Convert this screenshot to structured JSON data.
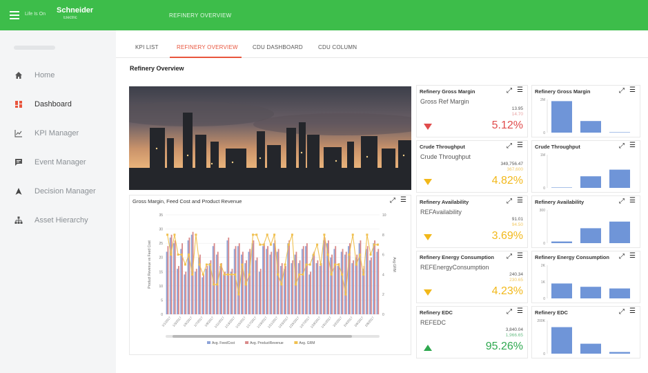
{
  "header": {
    "brand_small": "Life Is On",
    "brand": "Schneider",
    "brand_sub": "Electric",
    "page_title": "REFINERY OVERVIEW"
  },
  "sidebar": {
    "items": [
      {
        "label": "Home",
        "icon": "home-icon"
      },
      {
        "label": "Dashboard",
        "icon": "dashboard-icon"
      },
      {
        "label": "KPI Manager",
        "icon": "chart-line-icon"
      },
      {
        "label": "Event Manager",
        "icon": "message-icon"
      },
      {
        "label": "Decision Manager",
        "icon": "navigation-arrow-icon"
      },
      {
        "label": "Asset Hierarchy",
        "icon": "hierarchy-icon"
      }
    ]
  },
  "tabs": [
    "KPI LIST",
    "REFINERY OVERVIEW",
    "CDU DASHBOARD",
    "CDU COLUMN"
  ],
  "section_title": "Refinery Overview",
  "colors": {
    "header_green": "#3dbd4a",
    "tab_active": "#e8553d",
    "down_red": "#e04b4b",
    "down_yellow": "#f2b81a",
    "up_green": "#2ea84f",
    "feed_cost": "#8ea4d8",
    "product_revenue": "#d98a8a",
    "grm": "#f0c050",
    "mini_bar": "#6f95d8"
  },
  "kpis": [
    {
      "title": "Refinery Gross Margin",
      "sub": "Gross Ref Margin",
      "v1": "13.95",
      "v2": "14.70",
      "pct": "5.12%",
      "dir": "down",
      "color": "#e04b4b",
      "v2color": "#e8a0a0"
    },
    {
      "title": "Crude Throughput",
      "sub": "Crude Throughput",
      "v1": "349,756.47",
      "v2": "367,600",
      "pct": "4.82%",
      "dir": "down",
      "color": "#f2b81a",
      "v2color": "#f2c860"
    },
    {
      "title": "Refinery Availability",
      "sub": "REFAvailability",
      "v1": "91.01",
      "v2": "94.50",
      "pct": "3.69%",
      "dir": "down",
      "color": "#f2b81a",
      "v2color": "#f2c860"
    },
    {
      "title": "Refinery Energy Consumption",
      "sub": "REFEnergyConsumption",
      "v1": "240.34",
      "v2": "230.65",
      "pct": "4.23%",
      "dir": "down",
      "color": "#f2b81a",
      "v2color": "#f2c860"
    },
    {
      "title": "Refinery EDC",
      "sub": "REFEDC",
      "v1": "3,840.04",
      "v2": "1,966.65",
      "pct": "95.26%",
      "dir": "up",
      "color": "#2ea84f",
      "v2color": "#6bbf87"
    }
  ],
  "mini_charts": [
    {
      "title": "Refinery Gross Margin",
      "ticks": [
        "2M",
        "0"
      ],
      "values": [
        0.95,
        0.35,
        0
      ]
    },
    {
      "title": "Crude Throughput",
      "ticks": [
        "1M",
        "0"
      ],
      "values": [
        0,
        0.35,
        0.55
      ]
    },
    {
      "title": "Refinery Availability",
      "ticks": [
        "300",
        "0"
      ],
      "values": [
        0.05,
        0.45,
        0.65
      ]
    },
    {
      "title": "Refinery Energy Consumption",
      "ticks": [
        "2K",
        "1K",
        "0"
      ],
      "values": [
        0.45,
        0.35,
        0.3
      ]
    },
    {
      "title": "Refinery EDC",
      "ticks": [
        "200K",
        "0"
      ],
      "values": [
        0.8,
        0.3,
        0.05
      ]
    }
  ],
  "chart_data": {
    "type": "bar",
    "title": "Gross Margin, Feed Cost and Product Revenue",
    "ylabel": "Product Revenue vs Feed Cost",
    "y2label": "Avg GRM",
    "ylim": [
      0,
      35
    ],
    "y2lim": [
      0,
      10
    ],
    "yticks": [
      "35",
      "30",
      "25",
      "20",
      "15",
      "10",
      "5",
      "0"
    ],
    "y2ticks": [
      "10",
      "8",
      "6",
      "4",
      "2",
      "0"
    ],
    "xticks": [
      "1/1/2017",
      "1/3/2017",
      "1/5/2017",
      "1/7/2017",
      "1/9/2017",
      "1/11/2017",
      "1/13/2017",
      "1/15/2017",
      "1/17/2017",
      "1/19/2017",
      "1/21/2017",
      "1/23/2017",
      "1/25/2017",
      "1/27/2017",
      "1/29/2017",
      "1/31/2017",
      "2/2/2017",
      "2/4/2017",
      "2/6/2017",
      "2/8/2017"
    ],
    "series": [
      {
        "name": "Avg. FeedCost",
        "type": "bar",
        "values": [
          22,
          27,
          25,
          16,
          23,
          14,
          26,
          28,
          15,
          20,
          13,
          16,
          18,
          24,
          21,
          17,
          14,
          26,
          15,
          23,
          24,
          21,
          18,
          22,
          25,
          19,
          15,
          24,
          23,
          21,
          25,
          22,
          17,
          16,
          25,
          18,
          21,
          18,
          23,
          24,
          14,
          21,
          18,
          17,
          26,
          25,
          20,
          23,
          17,
          22,
          21,
          24,
          18,
          20,
          25,
          16,
          23,
          19,
          25,
          22
        ]
      },
      {
        "name": "Avg. ProductRevenue",
        "type": "bar",
        "values": [
          24,
          28,
          26,
          17,
          25,
          15,
          27,
          29,
          16,
          21,
          14,
          17,
          19,
          25,
          22,
          18,
          15,
          27,
          16,
          24,
          25,
          22,
          19,
          23,
          26,
          20,
          16,
          25,
          24,
          22,
          26,
          23,
          18,
          17,
          26,
          19,
          22,
          19,
          24,
          25,
          15,
          22,
          19,
          18,
          27,
          26,
          21,
          24,
          18,
          23,
          22,
          25,
          19,
          21,
          26,
          17,
          24,
          20,
          26,
          23
        ]
      },
      {
        "name": "Avg. GRM",
        "type": "line",
        "values": [
          8,
          6,
          8,
          6,
          6,
          5,
          6,
          4,
          8,
          5,
          4,
          5,
          5,
          3,
          3,
          5,
          4,
          4,
          4,
          4,
          2,
          5,
          3,
          4,
          8,
          8,
          7,
          7,
          8,
          7,
          8,
          4,
          3,
          5,
          7,
          8,
          3,
          4,
          4,
          5,
          5,
          6,
          7,
          5,
          8,
          6,
          4,
          5,
          5,
          4,
          2,
          6,
          8,
          5,
          6,
          4,
          8,
          6,
          7,
          7
        ]
      }
    ],
    "legend": "bottom"
  }
}
